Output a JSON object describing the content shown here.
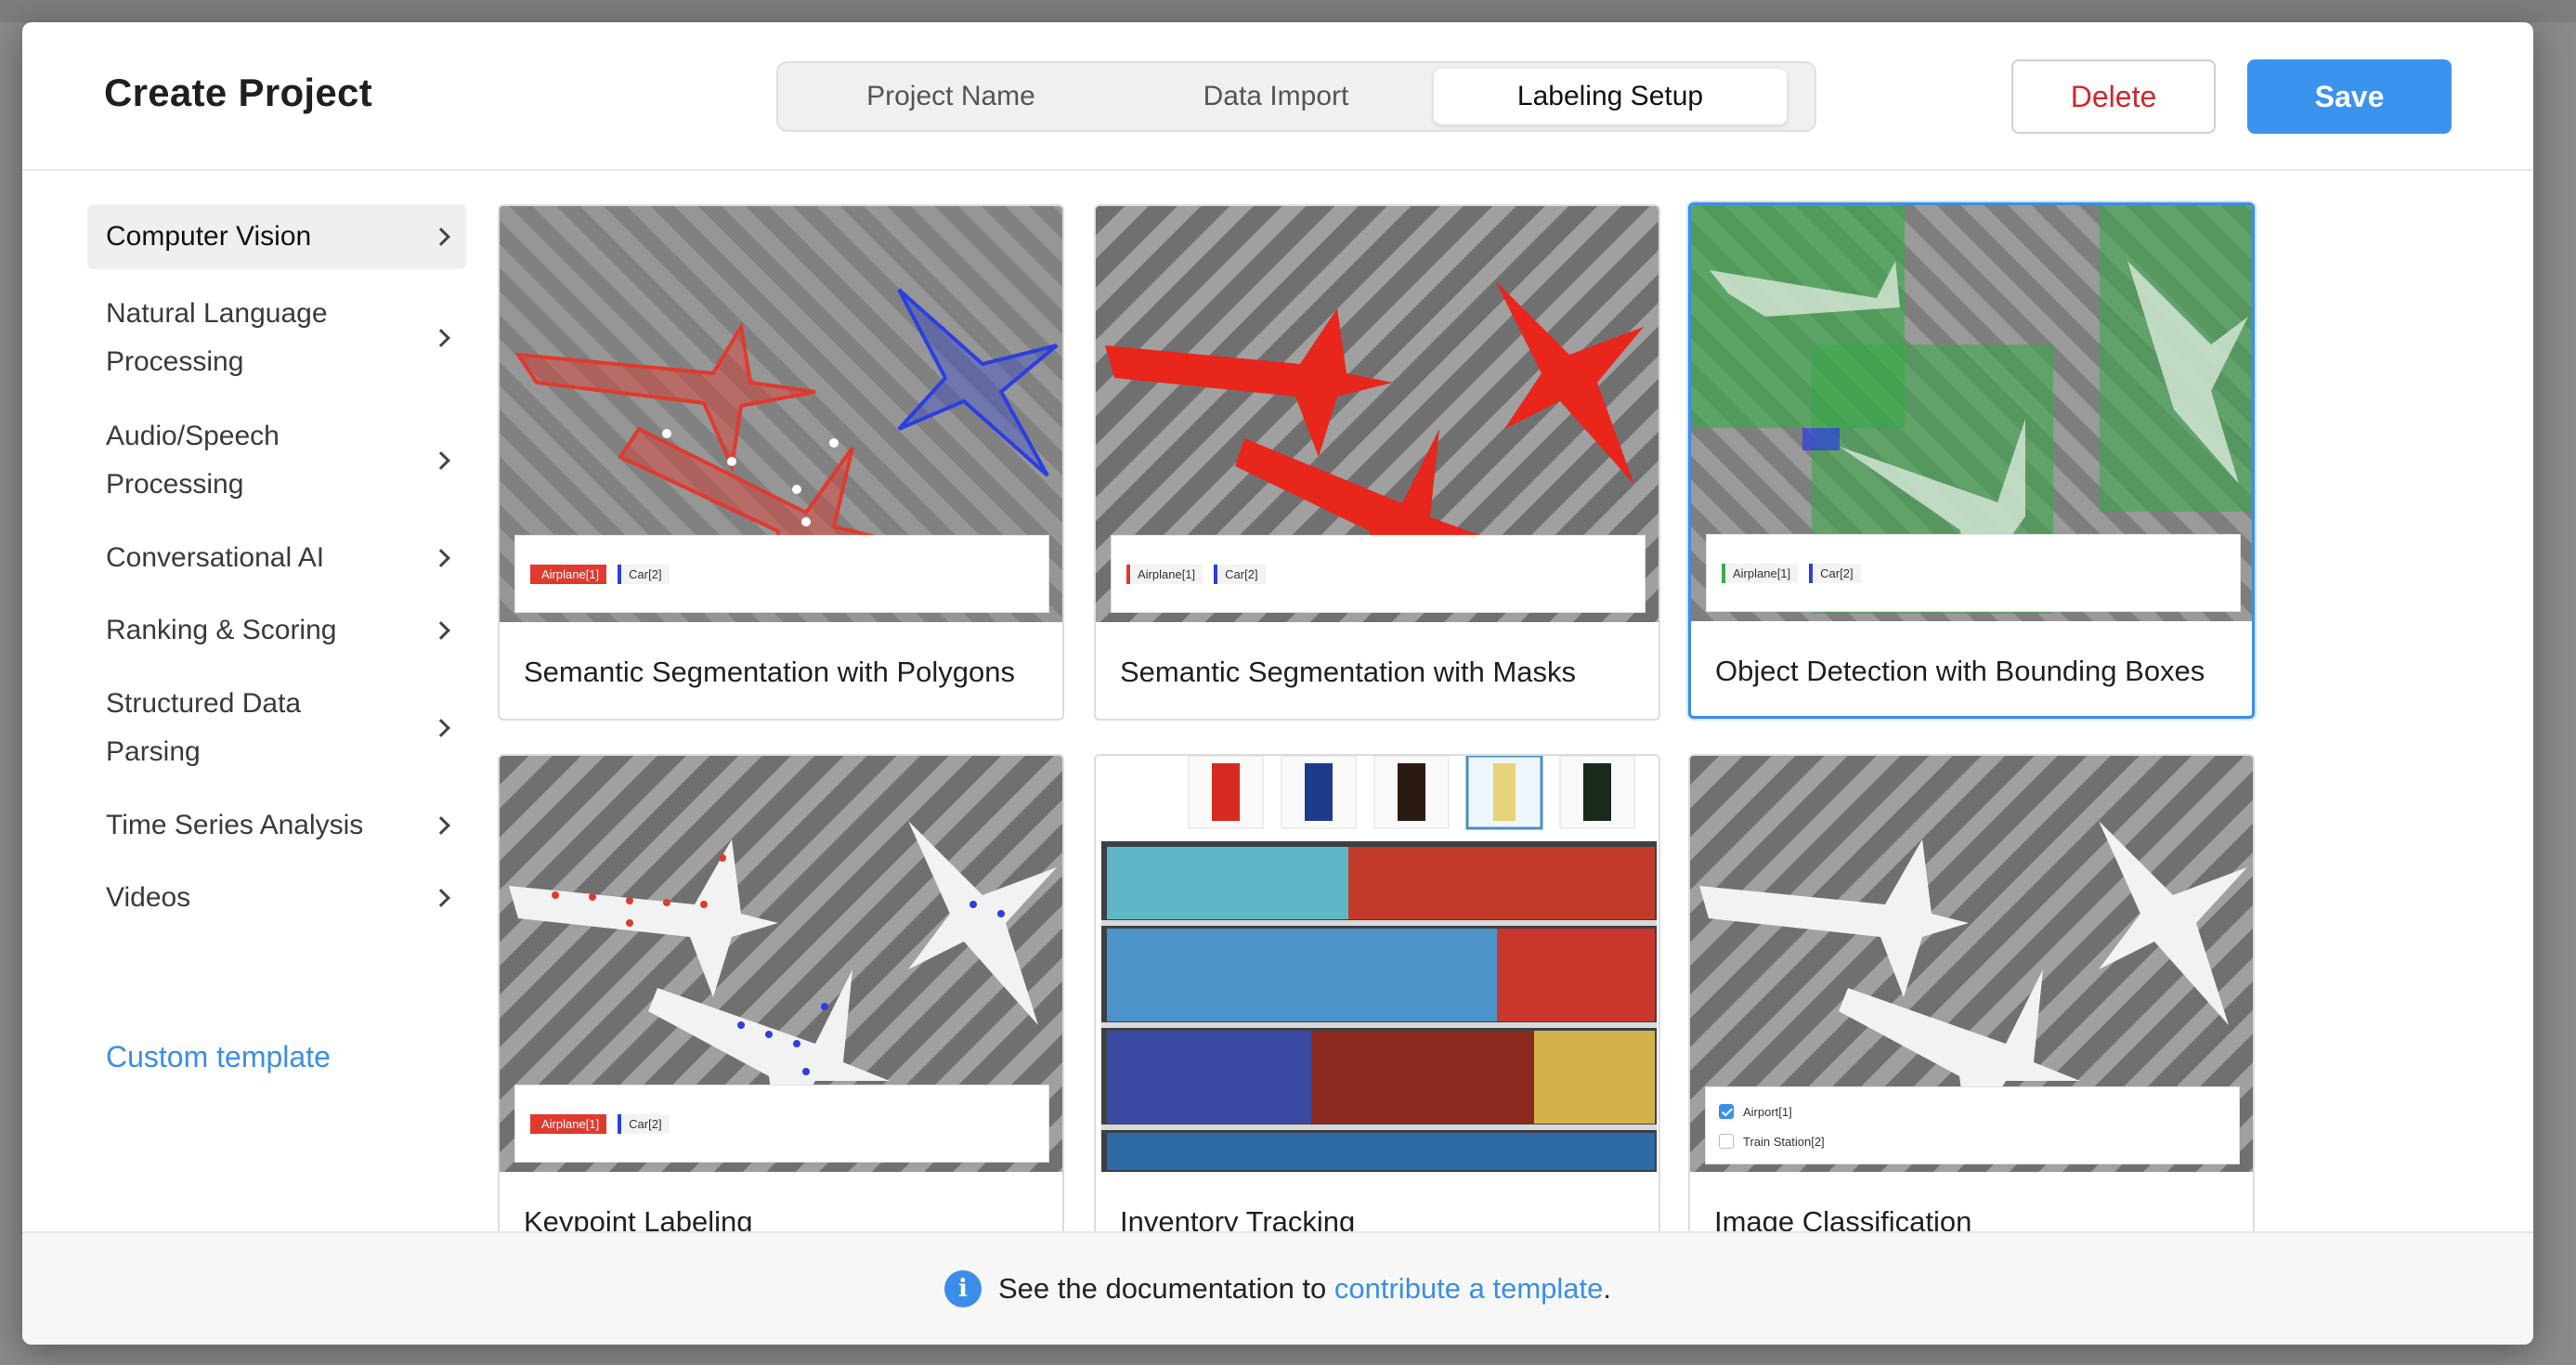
{
  "modal": {
    "title": "Create Project",
    "tabs": [
      {
        "label": "Project Name"
      },
      {
        "label": "Data Import"
      },
      {
        "label": "Labeling Setup"
      }
    ],
    "delete_label": "Delete",
    "save_label": "Save"
  },
  "sidebar": {
    "items": [
      {
        "label": "Computer Vision"
      },
      {
        "label": "Natural Language Processing"
      },
      {
        "label": "Audio/Speech Processing"
      },
      {
        "label": "Conversational AI"
      },
      {
        "label": "Ranking & Scoring"
      },
      {
        "label": "Structured Data Parsing"
      },
      {
        "label": "Time Series Analysis"
      },
      {
        "label": "Videos"
      }
    ],
    "custom_template": "Custom template"
  },
  "templates": [
    {
      "title": "Semantic Segmentation with Polygons",
      "chips": [
        "Airplane[1]",
        "Car[2]"
      ]
    },
    {
      "title": "Semantic Segmentation with Masks",
      "chips": [
        "Airplane[1]",
        "Car[2]"
      ]
    },
    {
      "title": "Object Detection with Bounding Boxes",
      "chips": [
        "Airplane[1]",
        "Car[2]"
      ]
    },
    {
      "title": "Keypoint Labeling",
      "chips": [
        "Airplane[1]",
        "Car[2]"
      ]
    },
    {
      "title": "Inventory Tracking",
      "chips": []
    },
    {
      "title": "Image Classification",
      "choices": [
        "Airport[1]",
        "Train Station[2]"
      ]
    }
  ],
  "footer": {
    "text_before": "See the documentation to",
    "link": "contribute a template",
    "text_after": "."
  },
  "colors": {
    "accent": "#3b8ee8",
    "save": "#3b93f0",
    "delete": "#d3262a",
    "airplane_red": "#e03a2f",
    "car_blue": "#2b3fe0",
    "bbox_green": "#3aa94a"
  }
}
